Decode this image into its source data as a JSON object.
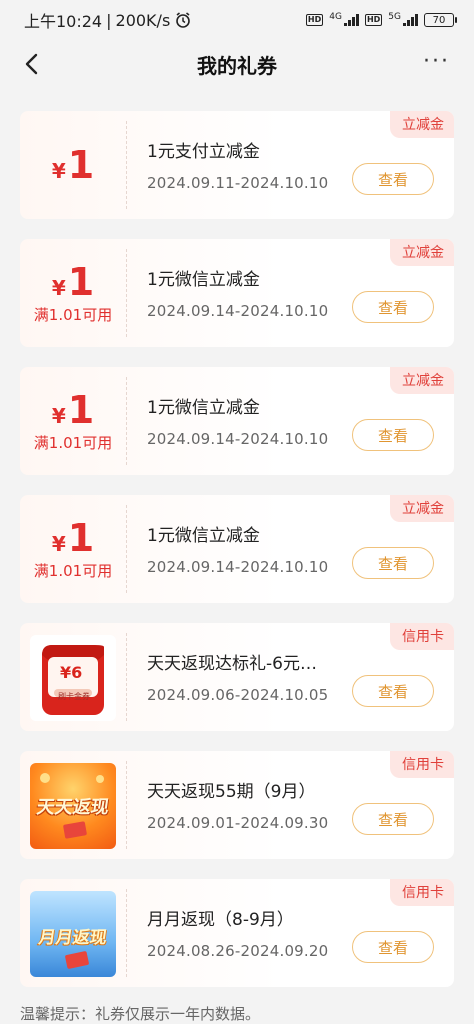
{
  "status": {
    "time": "上午10:24",
    "speed": "200K/s",
    "net1": "4G",
    "net2": "5G",
    "battery": "70",
    "hd": "HD"
  },
  "nav": {
    "title": "我的礼券",
    "more": "···"
  },
  "coupons": [
    {
      "yen": "¥",
      "amount": "1",
      "condition": "",
      "name": "1元支付立减金",
      "date": "2024.09.11-2024.10.10",
      "tag": "立减金",
      "button": "查看"
    },
    {
      "yen": "¥",
      "amount": "1",
      "condition": "满1.01可用",
      "name": "1元微信立减金",
      "date": "2024.09.14-2024.10.10",
      "tag": "立减金",
      "button": "查看"
    },
    {
      "yen": "¥",
      "amount": "1",
      "condition": "满1.01可用",
      "name": "1元微信立减金",
      "date": "2024.09.14-2024.10.10",
      "tag": "立减金",
      "button": "查看"
    },
    {
      "yen": "¥",
      "amount": "1",
      "condition": "满1.01可用",
      "name": "1元微信立减金",
      "date": "2024.09.14-2024.10.10",
      "tag": "立减金",
      "button": "查看"
    },
    {
      "thumb_text": "¥6",
      "thumb_sub": "刷卡金券",
      "name": "天天返现达标礼-6元…",
      "date": "2024.09.06-2024.10.05",
      "tag": "信用卡",
      "button": "查看"
    },
    {
      "thumb_text": "天天返现",
      "name": "天天返现55期（9月）",
      "date": "2024.09.01-2024.09.30",
      "tag": "信用卡",
      "button": "查看"
    },
    {
      "thumb_text": "月月返现",
      "name": "月月返现（8-9月）",
      "date": "2024.08.26-2024.09.20",
      "tag": "信用卡",
      "button": "查看"
    }
  ],
  "footer": {
    "tip": "温馨提示：礼券仅展示一年内数据。"
  },
  "colors": {
    "accent_red": "#e0302e",
    "tag_bg": "#fde6e3",
    "button_border": "#f0c27c",
    "button_text": "#e09530"
  }
}
